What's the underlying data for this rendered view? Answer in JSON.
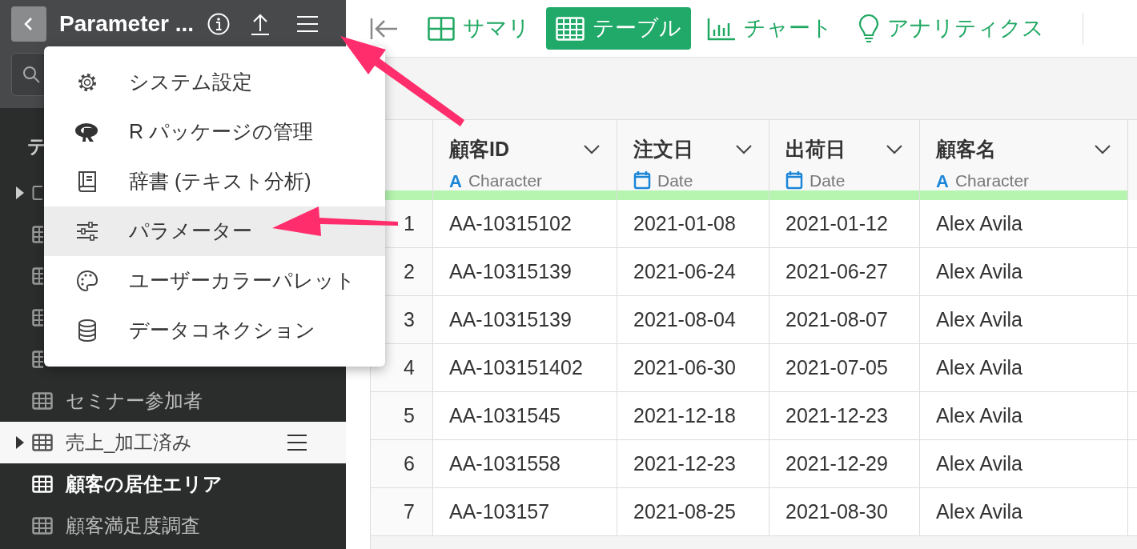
{
  "app_header": {
    "title": "Parameter ..."
  },
  "sidebar": {
    "heading": "テ",
    "items": [
      {
        "kind": "hidden_folder"
      },
      {
        "kind": "hidden_table"
      },
      {
        "kind": "hidden_table"
      },
      {
        "kind": "hidden_table"
      },
      {
        "kind": "hidden_table"
      },
      {
        "kind": "item",
        "label": "セミナー参加者",
        "expandable": false,
        "selected": false,
        "hovered": false
      },
      {
        "kind": "item",
        "label": "売上_加工済み",
        "expandable": true,
        "selected": false,
        "hovered": true
      },
      {
        "kind": "item",
        "label": "顧客の居住エリア",
        "expandable": false,
        "selected": true,
        "hovered": false
      },
      {
        "kind": "item",
        "label": "顧客満足度調査",
        "expandable": false,
        "selected": false,
        "hovered": false
      }
    ]
  },
  "menu": {
    "items": [
      {
        "kind": "settings",
        "label": "システム設定",
        "selected": false
      },
      {
        "kind": "r",
        "label": "R パッケージの管理",
        "selected": false
      },
      {
        "kind": "dictionary",
        "label": "辞書 (テキスト分析)",
        "selected": false
      },
      {
        "kind": "parameter",
        "label": "パラメーター",
        "selected": true
      },
      {
        "kind": "palette",
        "label": "ユーザーカラーパレット",
        "selected": false
      },
      {
        "kind": "database",
        "label": "データコネクション",
        "selected": false
      }
    ]
  },
  "tabs": [
    {
      "kind": "summary",
      "label": "サマリ",
      "selected": false
    },
    {
      "kind": "table",
      "label": "テーブル",
      "selected": true
    },
    {
      "kind": "chart",
      "label": "チャート",
      "selected": false
    },
    {
      "kind": "analytics",
      "label": "アナリティクス",
      "selected": false
    }
  ],
  "table": {
    "columns": [
      {
        "kind": "index"
      },
      {
        "name": "顧客ID",
        "kind": "character",
        "glyph": "A",
        "type_label": "Character"
      },
      {
        "name": "注文日",
        "kind": "date",
        "type_label": "Date"
      },
      {
        "name": "出荷日",
        "kind": "date",
        "type_label": "Date"
      },
      {
        "name": "顧客名",
        "kind": "character",
        "glyph": "A",
        "type_label": "Character"
      }
    ],
    "rows": [
      [
        "1",
        "AA-10315102",
        "2021-01-08",
        "2021-01-12",
        "Alex Avila"
      ],
      [
        "2",
        "AA-10315139",
        "2021-06-24",
        "2021-06-27",
        "Alex Avila"
      ],
      [
        "3",
        "AA-10315139",
        "2021-08-04",
        "2021-08-07",
        "Alex Avila"
      ],
      [
        "4",
        "AA-103151402",
        "2021-06-30",
        "2021-07-05",
        "Alex Avila"
      ],
      [
        "5",
        "AA-1031545",
        "2021-12-18",
        "2021-12-23",
        "Alex Avila"
      ],
      [
        "6",
        "AA-1031558",
        "2021-12-23",
        "2021-12-29",
        "Alex Avila"
      ],
      [
        "7",
        "AA-103157",
        "2021-08-25",
        "2021-08-30",
        "Alex Avila"
      ]
    ]
  }
}
